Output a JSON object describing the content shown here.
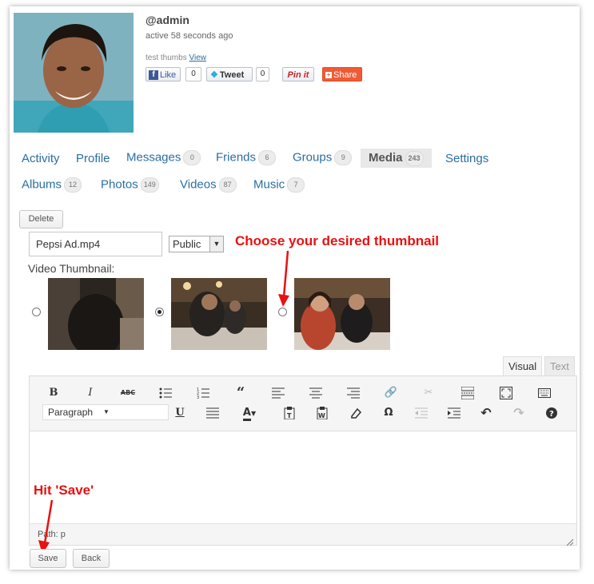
{
  "profile": {
    "username": "@admin",
    "active": "active 58 seconds ago",
    "status_text": "test thumbs",
    "status_link": "View"
  },
  "social": {
    "like_label": "Like",
    "like_count": "0",
    "tweet_label": "Tweet",
    "tweet_count": "0",
    "pin_label": "Pin it",
    "share_label": "Share"
  },
  "nav": {
    "primary": [
      {
        "label": "Activity"
      },
      {
        "label": "Profile"
      },
      {
        "label": "Messages",
        "count": "0"
      },
      {
        "label": "Friends",
        "count": "6"
      },
      {
        "label": "Groups",
        "count": "9"
      },
      {
        "label": "Media",
        "count": "243",
        "active": true
      },
      {
        "label": "Settings"
      }
    ],
    "secondary": [
      {
        "label": "Albums",
        "count": "12"
      },
      {
        "label": "Photos",
        "count": "149"
      },
      {
        "label": "Videos",
        "count": "87"
      },
      {
        "label": "Music",
        "count": "7"
      }
    ]
  },
  "form": {
    "delete_label": "Delete",
    "title_value": "Pepsi Ad.mp4",
    "privacy_selected": "Public",
    "thumbnail_label": "Video Thumbnail:",
    "selected_thumbnail": 1
  },
  "annotations": {
    "thumbnail_hint": "Choose your desired thumbnail",
    "save_hint": "Hit 'Save'"
  },
  "editor": {
    "tab_visual": "Visual",
    "tab_text": "Text",
    "format_selected": "Paragraph",
    "path": "Path: p"
  },
  "actions": {
    "save_label": "Save",
    "back_label": "Back"
  },
  "colors": {
    "link": "#2a6ea0",
    "annotation": "#e8110f",
    "share": "#f05a35"
  }
}
